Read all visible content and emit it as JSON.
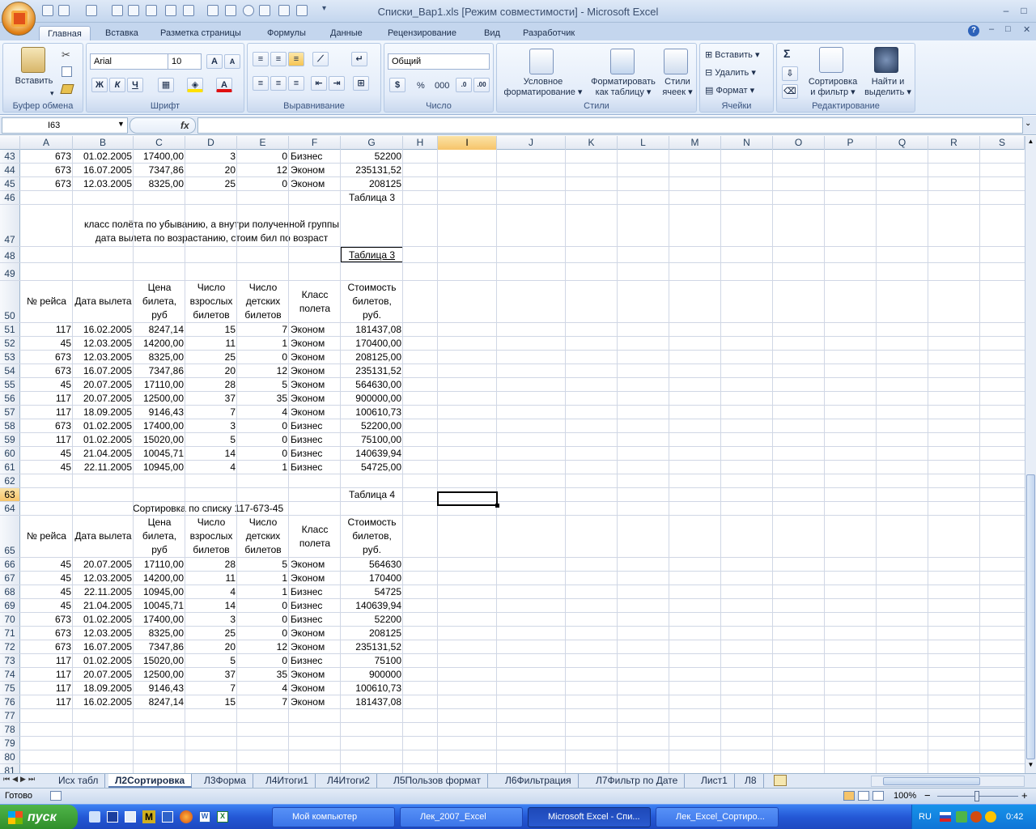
{
  "window": {
    "title": "Списки_Вар1.xls  [Режим совместимости] - Microsoft Excel",
    "min": "–",
    "max": "□",
    "close": "✕"
  },
  "ribbon": {
    "tabs": [
      "Главная",
      "Вставка",
      "Разметка страницы",
      "Формулы",
      "Данные",
      "Рецензирование",
      "Вид",
      "Разработчик"
    ],
    "clipboard": {
      "label": "Буфер обмена",
      "paste": "Вставить"
    },
    "font": {
      "label": "Шрифт",
      "family": "Arial",
      "size": "10",
      "bold": "Ж",
      "italic": "К",
      "underline": "Ч"
    },
    "alignment": {
      "label": "Выравнивание"
    },
    "number": {
      "label": "Число",
      "format": "Общий",
      "percent": "%",
      "thousands": "000"
    },
    "styles": {
      "label": "Стили",
      "cond_line1": "Условное",
      "cond_line2": "форматирование",
      "table_line1": "Форматировать",
      "table_line2": "как таблицу",
      "cell_line1": "Стили",
      "cell_line2": "ячеек"
    },
    "cells": {
      "label": "Ячейки",
      "insert": "Вставить",
      "delete": "Удалить",
      "format": "Формат"
    },
    "editing": {
      "label": "Редактирование",
      "sigma": "Σ",
      "sort_line1": "Сортировка",
      "sort_line2": "и фильтр",
      "find_line1": "Найти и",
      "find_line2": "выделить"
    }
  },
  "formula_bar": {
    "name_box": "I63",
    "fx": "fx",
    "formula": ""
  },
  "columns": [
    "A",
    "B",
    "C",
    "D",
    "E",
    "F",
    "G",
    "H",
    "I",
    "J",
    "K",
    "L",
    "M",
    "N",
    "O",
    "P",
    "Q",
    "R",
    "S"
  ],
  "headers_block": {
    "c1": "№ рейса",
    "c2": "Дата вылета",
    "c3": "Цена билета, руб",
    "c4": "Число взрослых билетов",
    "c5": "Число детских билетов",
    "c6": "Класс полета",
    "c7": "Стоимость билетов, руб."
  },
  "rows": [
    {
      "n": "43",
      "v": [
        "673",
        "01.02.2005",
        "17400,00",
        "3",
        "0",
        "Бизнес",
        "52200"
      ]
    },
    {
      "n": "44",
      "v": [
        "673",
        "16.07.2005",
        "7347,86",
        "20",
        "12",
        "Эконом",
        "235131,52"
      ]
    },
    {
      "n": "45",
      "v": [
        "673",
        "12.03.2005",
        "8325,00",
        "25",
        "0",
        "Эконом",
        "208125"
      ]
    },
    {
      "n": "46",
      "label": "Таблица 3"
    },
    {
      "n": "47",
      "note1": "класс полёта по убыванию, а внутри полученной группы",
      "note2": "дата вылета по возрастанию, стоим бил по возраст"
    },
    {
      "n": "48",
      "label": "Таблица 3"
    },
    {
      "n": "49"
    },
    {
      "n": "50",
      "hdr": true
    },
    {
      "n": "51",
      "v": [
        "117",
        "16.02.2005",
        "8247,14",
        "15",
        "7",
        "Эконом",
        "181437,08"
      ]
    },
    {
      "n": "52",
      "v": [
        "45",
        "12.03.2005",
        "14200,00",
        "11",
        "1",
        "Эконом",
        "170400,00"
      ]
    },
    {
      "n": "53",
      "v": [
        "673",
        "12.03.2005",
        "8325,00",
        "25",
        "0",
        "Эконом",
        "208125,00"
      ]
    },
    {
      "n": "54",
      "v": [
        "673",
        "16.07.2005",
        "7347,86",
        "20",
        "12",
        "Эконом",
        "235131,52"
      ]
    },
    {
      "n": "55",
      "v": [
        "45",
        "20.07.2005",
        "17110,00",
        "28",
        "5",
        "Эконом",
        "564630,00"
      ]
    },
    {
      "n": "56",
      "v": [
        "117",
        "20.07.2005",
        "12500,00",
        "37",
        "35",
        "Эконом",
        "900000,00"
      ]
    },
    {
      "n": "57",
      "v": [
        "117",
        "18.09.2005",
        "9146,43",
        "7",
        "4",
        "Эконом",
        "100610,73"
      ]
    },
    {
      "n": "58",
      "v": [
        "673",
        "01.02.2005",
        "17400,00",
        "3",
        "0",
        "Бизнес",
        "52200,00"
      ]
    },
    {
      "n": "59",
      "v": [
        "117",
        "01.02.2005",
        "15020,00",
        "5",
        "0",
        "Бизнес",
        "75100,00"
      ]
    },
    {
      "n": "60",
      "v": [
        "45",
        "21.04.2005",
        "10045,71",
        "14",
        "0",
        "Бизнес",
        "140639,94"
      ]
    },
    {
      "n": "61",
      "v": [
        "45",
        "22.11.2005",
        "10945,00",
        "4",
        "1",
        "Бизнес",
        "54725,00"
      ]
    },
    {
      "n": "62"
    },
    {
      "n": "63",
      "label": "Таблица 4"
    },
    {
      "n": "64",
      "sortnote": "Сортировка по списку 117-673-45"
    },
    {
      "n": "65",
      "hdr": true
    },
    {
      "n": "66",
      "v": [
        "45",
        "20.07.2005",
        "17110,00",
        "28",
        "5",
        "Эконом",
        "564630"
      ]
    },
    {
      "n": "67",
      "v": [
        "45",
        "12.03.2005",
        "14200,00",
        "11",
        "1",
        "Эконом",
        "170400"
      ]
    },
    {
      "n": "68",
      "v": [
        "45",
        "22.11.2005",
        "10945,00",
        "4",
        "1",
        "Бизнес",
        "54725"
      ]
    },
    {
      "n": "69",
      "v": [
        "45",
        "21.04.2005",
        "10045,71",
        "14",
        "0",
        "Бизнес",
        "140639,94"
      ]
    },
    {
      "n": "70",
      "v": [
        "673",
        "01.02.2005",
        "17400,00",
        "3",
        "0",
        "Бизнес",
        "52200"
      ]
    },
    {
      "n": "71",
      "v": [
        "673",
        "12.03.2005",
        "8325,00",
        "25",
        "0",
        "Эконом",
        "208125"
      ]
    },
    {
      "n": "72",
      "v": [
        "673",
        "16.07.2005",
        "7347,86",
        "20",
        "12",
        "Эконом",
        "235131,52"
      ]
    },
    {
      "n": "73",
      "v": [
        "117",
        "01.02.2005",
        "15020,00",
        "5",
        "0",
        "Бизнес",
        "75100"
      ]
    },
    {
      "n": "74",
      "v": [
        "117",
        "20.07.2005",
        "12500,00",
        "37",
        "35",
        "Эконом",
        "900000"
      ]
    },
    {
      "n": "75",
      "v": [
        "117",
        "18.09.2005",
        "9146,43",
        "7",
        "4",
        "Эконом",
        "100610,73"
      ]
    },
    {
      "n": "76",
      "v": [
        "117",
        "16.02.2005",
        "8247,14",
        "15",
        "7",
        "Эконом",
        "181437,08"
      ]
    },
    {
      "n": "77"
    },
    {
      "n": "78"
    },
    {
      "n": "79"
    },
    {
      "n": "80"
    },
    {
      "n": "81"
    }
  ],
  "sheet_tabs": [
    "Исх табл",
    "Л2Сортировка",
    "Л3Форма",
    "Л4Итоги1",
    "Л4Итоги2",
    "Л5Пользов формат",
    "Л6Фильтрация",
    "Л7Фильтр по Дате",
    "Лист1",
    "Л8"
  ],
  "status": {
    "ready": "Готово",
    "zoom": "100%",
    "minus": "−",
    "plus": "+"
  },
  "taskbar": {
    "start": "пуск",
    "tasks": [
      "Мой компьютер",
      "Лек_2007_Excel",
      "Microsoft Excel - Спи...",
      "Лек_Excel_Сортиро..."
    ],
    "lang": "RU",
    "clock": "0:42"
  }
}
